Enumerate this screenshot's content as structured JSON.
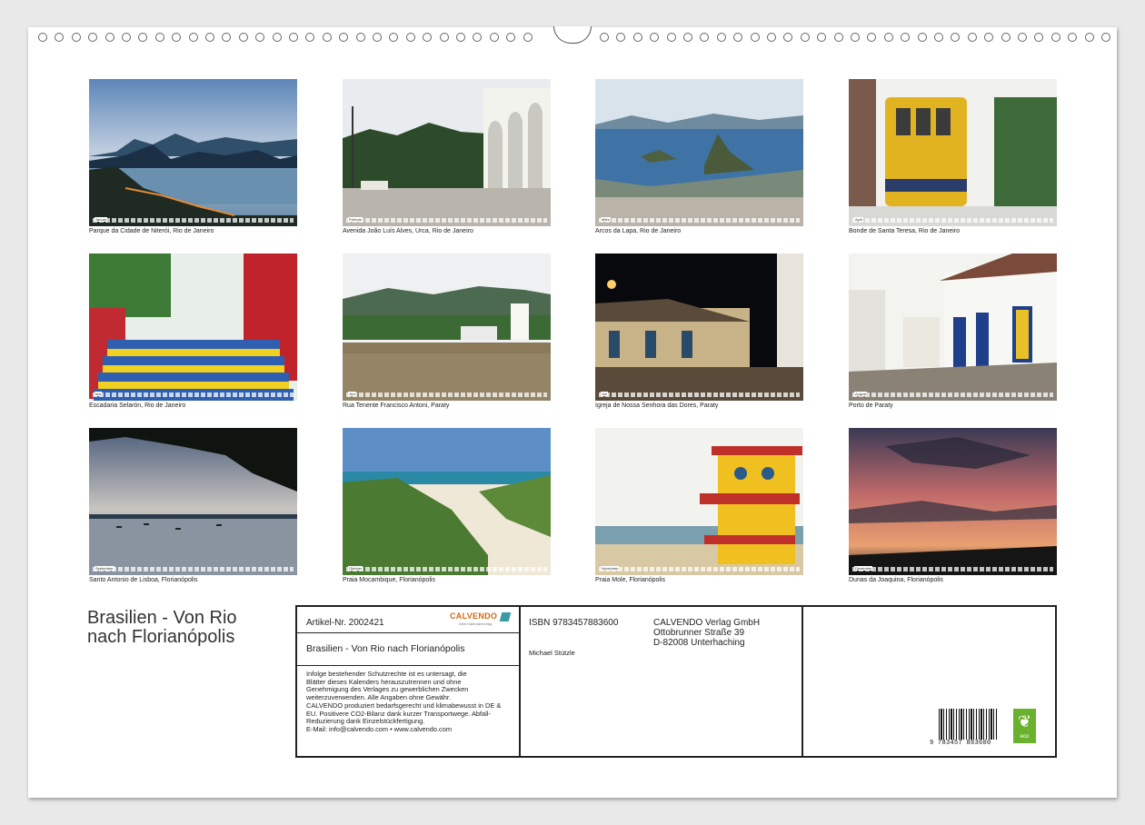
{
  "photos": [
    {
      "caption": "Parque da Cidade de Niterói, Rio de Janeiro",
      "month": "Januar"
    },
    {
      "caption": "Avenida João Luís Alves, Urca, Rio de Janeiro",
      "month": "Februar"
    },
    {
      "caption": "Arcos da Lapa, Rio de Janeiro",
      "month": "März"
    },
    {
      "caption": "Bonde de Santa Teresa, Rio de Janeiro",
      "month": "April"
    },
    {
      "caption": "Escadaria Selarón, Rio de Janeiro",
      "month": "Mai"
    },
    {
      "caption": "Rua Tenente Francisco Antoni, Paraty",
      "month": "Juni"
    },
    {
      "caption": "Igreja de Nossa Senhora das Dores, Paraty",
      "month": "Juli"
    },
    {
      "caption": "Porto de Paraty",
      "month": "August"
    },
    {
      "caption": "Santo Antonio de Lisboa, Florianópolis",
      "month": "September"
    },
    {
      "caption": "Praia Mocambique, Florianópolis",
      "month": "Oktober"
    },
    {
      "caption": "Praia Mole, Florianópolis",
      "month": "November"
    },
    {
      "caption": "Dunas da Joaquina, Florianópolis",
      "month": "Dezember"
    }
  ],
  "calendar_title_line1": "Brasilien - Von Rio",
  "calendar_title_line2": "nach Florianópolis",
  "info": {
    "article_number": "Artikel-Nr. 2002421",
    "brand": "CALVENDO",
    "brand_sub": "Dein Kalenderverlag",
    "product_title": "Brasilien - Von Rio nach Florianópolis",
    "legal_lines": [
      "Infolge bestehender Schutzrechte ist es untersagt, die",
      "Blätter dieses Kalenders herauszutrennen und ohne",
      "Genehmigung des Verlages zu gewerblichen Zwecken",
      "weiterzuverwenden. Alle Angaben ohne Gewähr.",
      "CALVENDO produziert bedarfsgerecht und klimabewusst in DE &",
      "EU. Positivere CO2-Bilanz dank kurzer Transportwege. Abfall-",
      "Reduzierung dank Einzelstückfertigung.",
      "E-Mail: info@calvendo.com • www.calvendo.com"
    ],
    "isbn": "ISBN 9783457883600",
    "author": "Michael Stützle",
    "publisher_lines": [
      "CALVENDO Verlag GmbH",
      "Ottobrunner Straße 39",
      "D-82008 Unterhaching"
    ],
    "barcode_number": "9 783457 883600",
    "eco_label": "eco"
  },
  "colors": {
    "sheet": "#ffffff",
    "border": "#222222",
    "brand_orange": "#d16a13",
    "eco_green": "#6ab22e"
  }
}
